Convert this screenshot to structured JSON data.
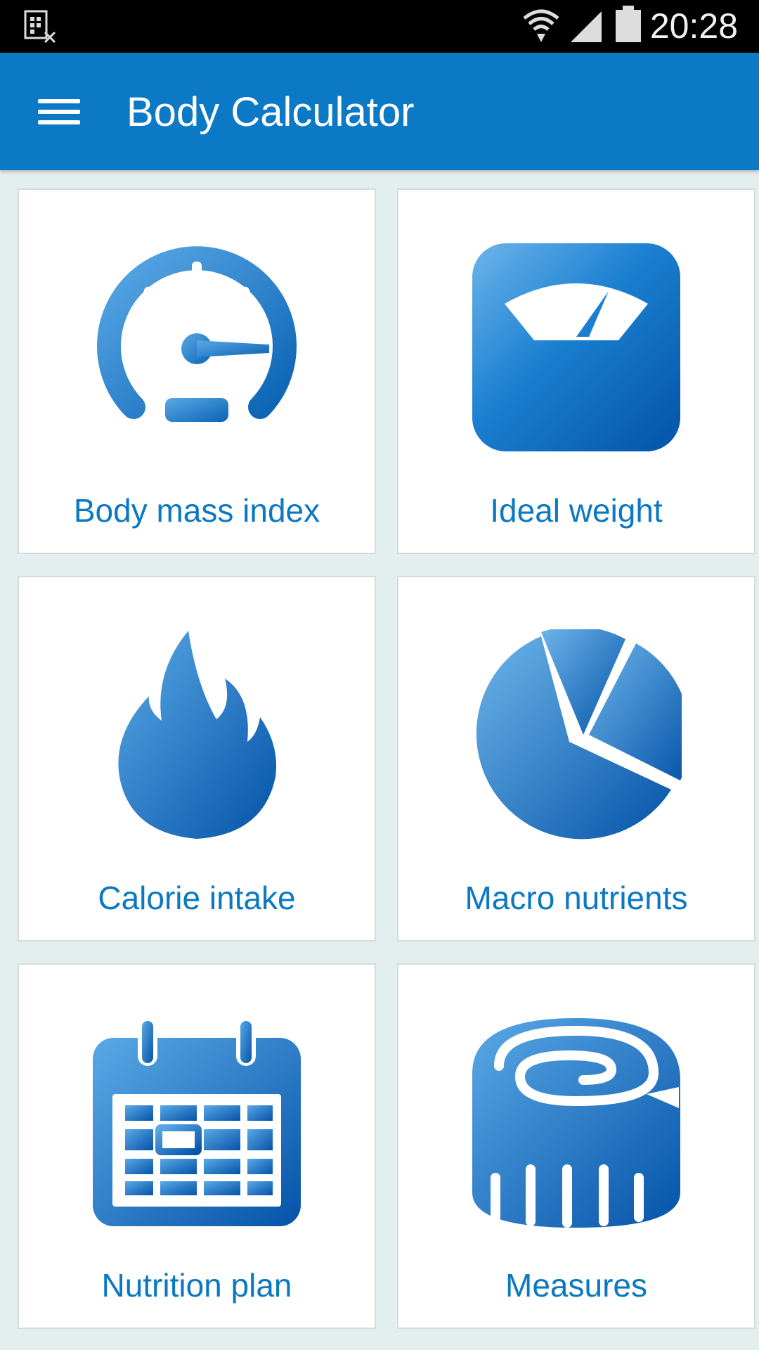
{
  "status_bar": {
    "time": "20:28"
  },
  "app_bar": {
    "title": "Body Calculator"
  },
  "cards": [
    {
      "label": "Body mass index",
      "icon": "speedometer-icon"
    },
    {
      "label": "Ideal weight",
      "icon": "scale-icon"
    },
    {
      "label": "Calorie intake",
      "icon": "flame-icon"
    },
    {
      "label": "Macro nutrients",
      "icon": "pie-chart-icon"
    },
    {
      "label": "Nutrition plan",
      "icon": "calendar-icon"
    },
    {
      "label": "Measures",
      "icon": "measuring-tape-icon"
    }
  ],
  "colors": {
    "primary": "#0c79c6",
    "label": "#0a78c2",
    "background": "#e3eeee"
  }
}
